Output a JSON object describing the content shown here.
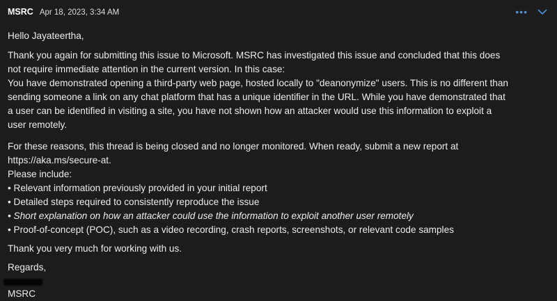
{
  "header": {
    "sender": "MSRC",
    "date": "Apr 18, 2023, 3:34 AM",
    "more_icon": "ellipsis-icon",
    "expand_icon": "chevron-down-icon",
    "accent": "#4f8fd6"
  },
  "body": {
    "greeting": "Hello Jayateertha,",
    "para1": [
      "Thank you again for submitting this issue to Microsoft. MSRC has investigated this issue and concluded that this does",
      "not require immediate attention in the current version. In this case:",
      "You have demonstrated opening a third-party web page, hosted locally to \"deanonymize\" users. This is no different than",
      "sending someone a link on any chat platform that has a unique identifier in the URL. While you have demonstrated that",
      "a user can be identified in visiting a site, you have not shown how an attacker would use this information to exploit a",
      "user remotely."
    ],
    "para2": [
      "For these reasons, this thread is being closed and no longer monitored. When ready, submit a new report at",
      "https://aka.ms/secure-at.",
      "Please include:"
    ],
    "bullets": [
      "• Relevant information previously provided in your initial report",
      "• Detailed steps required to consistently reproduce the issue",
      "• Short explanation on how an attacker could use the information to exploit another user remotely",
      "• Proof-of-concept (POC), such as a video recording, crash reports, screenshots, or relevant code samples"
    ],
    "thanks": "Thank you very much for working with us.",
    "regards": "Regards,",
    "signature": "MSRC"
  }
}
